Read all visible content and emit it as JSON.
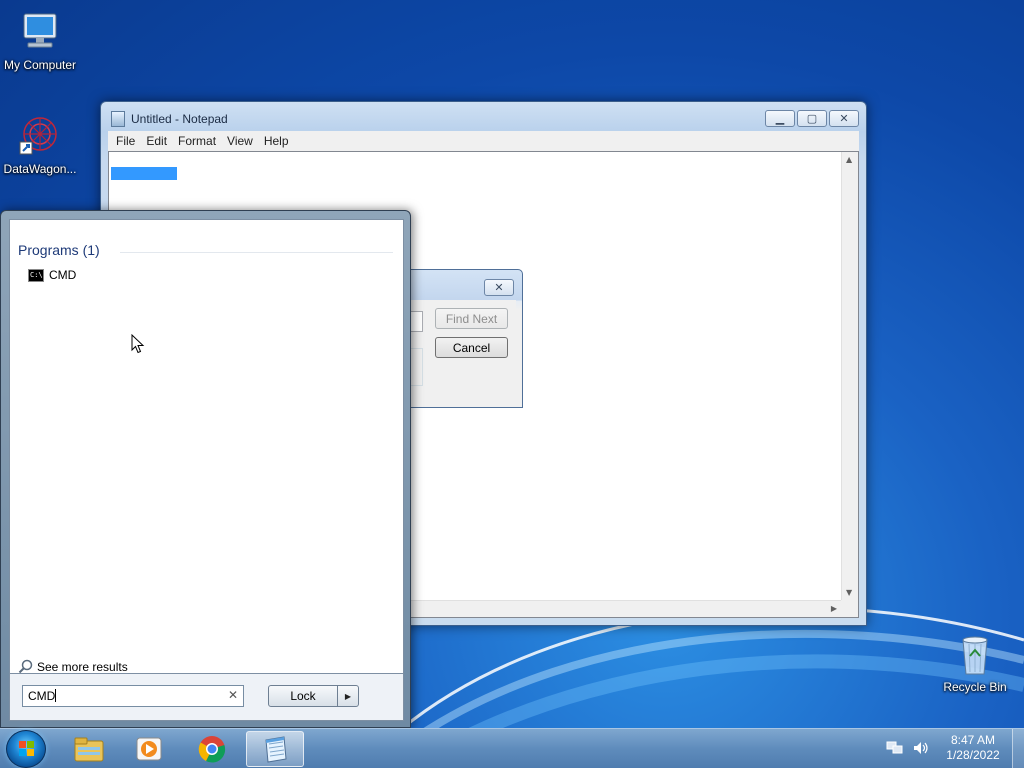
{
  "desktop": {
    "icons": [
      {
        "label": "My Computer",
        "icon": "computer-icon"
      },
      {
        "label": "DataWagon...",
        "icon": "datawagon-icon"
      },
      {
        "label": "Recycle Bin",
        "icon": "recycle-bin-icon"
      }
    ]
  },
  "notepad": {
    "title": "Untitled - Notepad",
    "menu": [
      "File",
      "Edit",
      "Format",
      "View",
      "Help"
    ],
    "buttons": {
      "minimize": "minimize-icon",
      "maximize": "maximize-icon",
      "close": "close-icon"
    }
  },
  "find_dialog": {
    "find_next_label": "Find Next",
    "cancel_label": "Cancel"
  },
  "start_menu": {
    "section_header": "Programs (1)",
    "results": [
      {
        "label": "CMD",
        "icon": "cmd-icon"
      }
    ],
    "see_more": "See more results",
    "search_value": "CMD",
    "lock_label": "Lock"
  },
  "taskbar": {
    "pinned": [
      "file-explorer-icon",
      "media-player-icon",
      "chrome-icon",
      "notepad-icon"
    ],
    "active_app": "notepad-icon",
    "clock_time": "8:47 AM",
    "clock_date": "1/28/2022"
  },
  "colors": {
    "selection": "#3399ff",
    "header_blue": "#1e3a78"
  }
}
